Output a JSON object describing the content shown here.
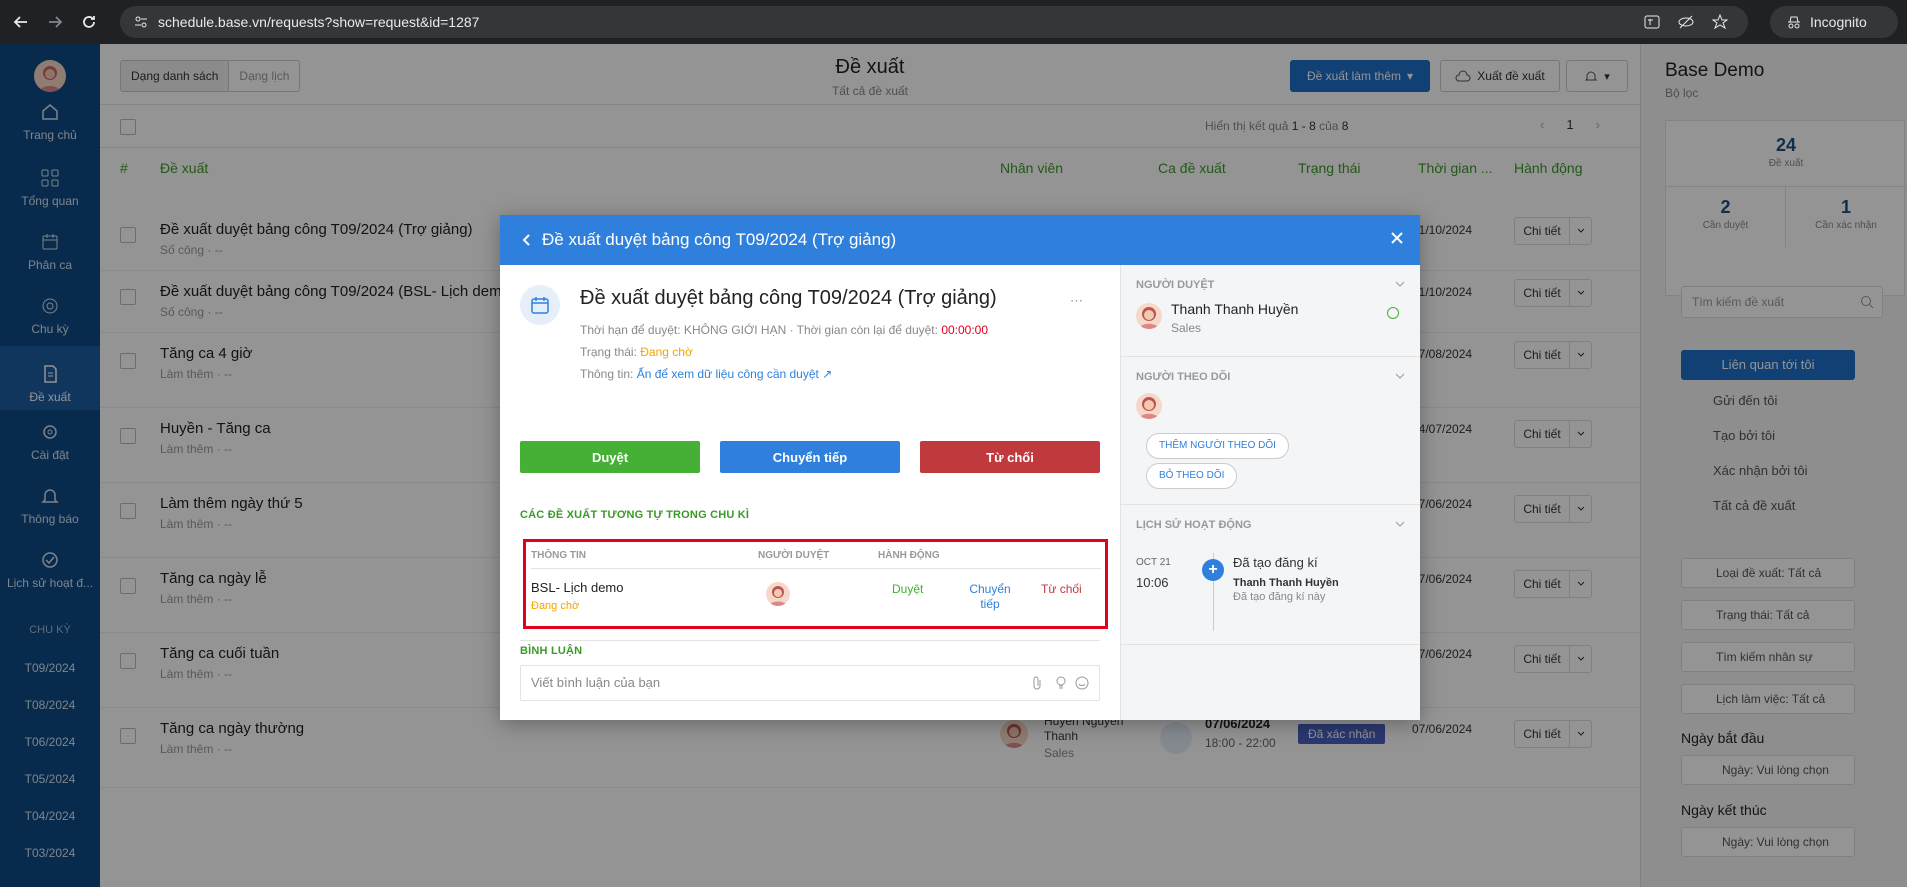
{
  "browser": {
    "url": "schedule.base.vn/requests?show=request&id=1287",
    "incognito_label": "Incognito"
  },
  "sidebar": {
    "items": [
      {
        "label": "Trang chủ",
        "icon": "home-icon"
      },
      {
        "label": "Tổng quan",
        "icon": "grid-icon"
      },
      {
        "label": "Phân ca",
        "icon": "calendar-edit-icon"
      },
      {
        "label": "Chu kỳ",
        "icon": "cycle-icon"
      },
      {
        "label": "Đề xuất",
        "icon": "request-icon"
      },
      {
        "label": "Cài đặt",
        "icon": "gear-icon"
      },
      {
        "label": "Thông báo",
        "icon": "bell-icon"
      },
      {
        "label": "Lịch sử hoạt đ...",
        "icon": "check-circle-icon"
      }
    ],
    "period_title": "CHU KỲ",
    "periods": [
      "T09/2024",
      "T08/2024",
      "T06/2024",
      "T05/2024",
      "T04/2024",
      "T03/2024"
    ]
  },
  "main": {
    "view_list": "Dạng danh sách",
    "view_calendar": "Dạng lịch",
    "title": "Đề xuất",
    "subtitle": "Tất cả đề xuất",
    "btn_more": "Đề xuất làm thêm",
    "btn_export": "Xuất đề xuất",
    "results_prefix": "Hiển thị kết quả",
    "results_range": "1 - 8",
    "results_of": "của",
    "results_total": "8",
    "page": "1",
    "columns": {
      "num": "#",
      "request": "Đề xuất",
      "staff": "Nhân viên",
      "shift": "Ca đề xuất",
      "status": "Trạng thái",
      "time": "Thời gian ...",
      "action": "Hành động"
    },
    "rows": [
      {
        "title": "Đề xuất duyệt bảng công T09/2024 (Trợ giảng)",
        "sub": "Số công · --",
        "date": "21/10/2024",
        "action": "Chi tiết"
      },
      {
        "title": "Đề xuất duyệt bảng công T09/2024 (BSL- Lịch dem",
        "sub": "Số công · --",
        "date": "21/10/2024",
        "action": "Chi tiết"
      },
      {
        "title": "Tăng ca 4 giờ",
        "sub": "Làm thêm · --",
        "date": "17/08/2024",
        "action": "Chi tiết"
      },
      {
        "title": "Huyền - Tăng ca",
        "sub": "Làm thêm · --",
        "date": "24/07/2024",
        "action": "Chi tiết"
      },
      {
        "title": "Làm thêm ngày thứ 5",
        "sub": "Làm thêm · --",
        "date": "07/06/2024",
        "action": "Chi tiết"
      },
      {
        "title": "Tăng ca ngày lễ",
        "sub": "Làm thêm · --",
        "date": "07/06/2024",
        "action": "Chi tiết"
      },
      {
        "title": "Tăng ca cuối tuần",
        "sub": "Làm thêm · --",
        "date": "07/06/2024",
        "action": "Chi tiết"
      },
      {
        "title": "Tăng ca ngày thường",
        "sub": "Làm thêm · --",
        "date": "07/06/2024",
        "action": "Chi tiết"
      }
    ],
    "last_row_staff": "Huyền Nguyễn Thanh",
    "last_row_team": "Sales",
    "last_row_shift_date": "07/06/2024",
    "last_row_shift_time": "18:00 - 22:00",
    "last_row_status": "Đã xác nhận"
  },
  "right_panel": {
    "title": "Base Demo",
    "subtitle": "Bộ lọc",
    "total": "24",
    "total_label": "Đề xuất",
    "pending": "2",
    "pending_label": "Cần duyệt",
    "confirm": "1",
    "confirm_label": "Cần xác nhận",
    "search_placeholder": "Tìm kiếm đề xuất",
    "filters": [
      "Liên quan tới tôi",
      "Gửi đến tôi",
      "Tạo bởi tôi",
      "Xác nhận bởi tôi",
      "Tất cả đề xuất"
    ],
    "type_select": "Loại đề xuất: Tất cả",
    "status_select": "Trạng thái: Tất cả",
    "staff_search": "Tìm kiếm nhân sự",
    "schedule_select": "Lịch làm việc: Tất cả",
    "start_label": "Ngày bắt đầu",
    "start_placeholder": "Ngày: Vui lòng chọn",
    "end_label": "Ngày kết thúc",
    "end_placeholder": "Ngày: Vui lòng chọn"
  },
  "modal": {
    "header": "Đề xuất duyệt bảng công T09/2024 (Trợ giảng)",
    "title": "Đề xuất duyệt bảng công T09/2024 (Trợ giảng)",
    "deadline_text": "Thời hạn để duyệt: KHÔNG GIỚI HẠN · Thời gian còn lại để duyệt:",
    "deadline_timer": "00:00:00",
    "status_label": "Trạng thái:",
    "status_value": "Đang chờ",
    "info_label": "Thông tin:",
    "info_link": "Ấn để xem dữ liệu công cần duyệt",
    "btn_approve": "Duyệt",
    "btn_forward": "Chuyển tiếp",
    "btn_reject": "Từ chối",
    "similar_title": "CÁC ĐỀ XUẤT TƯƠNG TỰ TRONG CHU KÌ",
    "similar_cols": {
      "info": "THÔNG TIN",
      "approver": "NGƯỜI DUYỆT",
      "action": "HÀNH ĐỘNG"
    },
    "similar_row": {
      "name": "BSL- Lịch demo",
      "status": "Đang chờ",
      "approve": "Duyệt",
      "forward_1": "Chuyển",
      "forward_2": "tiếp",
      "reject": "Từ chối"
    },
    "comment_title": "BÌNH LUẬN",
    "comment_placeholder": "Viết bình luận của bạn",
    "approver_title": "NGƯỜI DUYỆT",
    "approver_name": "Thanh Thanh Huyền",
    "approver_team": "Sales",
    "follower_title": "NGƯỜI THEO DÕI",
    "add_follower": "THÊM NGƯỜI THEO DÕI",
    "unfollow": "BỎ THEO DÕI",
    "history_title": "LỊCH SỬ HOẠT ĐỘNG",
    "history_date": "OCT 21",
    "history_time": "10:06",
    "history_event": "Đã tạo đăng kí",
    "history_actor": "Thanh Thanh Huyền",
    "history_detail": "Đã tạo đăng kí này"
  },
  "colors": {
    "sidebar": "#0e4a86",
    "primary": "#1e6fc8",
    "approve": "#45b035",
    "forward": "#2f80dd",
    "reject": "#c0393d",
    "accent_green": "#3a9a26",
    "pending": "#f0a500",
    "highlight": "#e2001a"
  }
}
